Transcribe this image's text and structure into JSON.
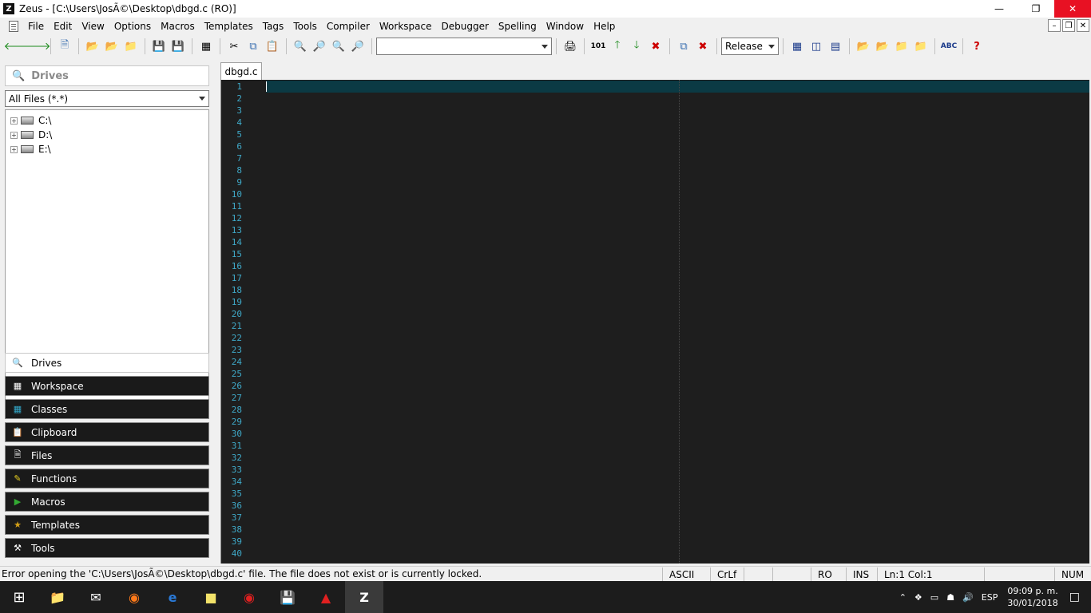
{
  "window": {
    "app_icon": "Z",
    "title": "Zeus - [C:\\Users\\JosÃ©\\Desktop\\dbgd.c (RO)]",
    "buttons": [
      "minimize-icon",
      "restore-icon",
      "close-icon"
    ]
  },
  "menu": {
    "items": [
      "File",
      "Edit",
      "View",
      "Options",
      "Macros",
      "Templates",
      "Tags",
      "Tools",
      "Compiler",
      "Workspace",
      "Debugger",
      "Spelling",
      "Window",
      "Help"
    ]
  },
  "toolbar": {
    "search_combo_value": "",
    "config_combo_value": "Release"
  },
  "leftpanel": {
    "header": "Drives",
    "filter": "All Files (*.*)",
    "tree": [
      "C:\\",
      "D:\\",
      "E:\\"
    ],
    "buttons": [
      "Drives",
      "Workspace",
      "Classes",
      "Clipboard",
      "Files",
      "Functions",
      "Macros",
      "Templates",
      "Tools"
    ]
  },
  "editor": {
    "tab": "dbgd.c",
    "line_count": 40
  },
  "status": {
    "message": "Error opening the 'C:\\Users\\JosÃ©\\Desktop\\dbgd.c' file. The file does not exist or is currently locked.",
    "encoding": "ASCII",
    "line_ending": "CrLf",
    "mode": "RO",
    "insert": "INS",
    "position": "Ln:1 Col:1",
    "numlock": "NUM"
  },
  "taskbar": {
    "language": "ESP",
    "time": "09:09 p. m.",
    "date": "30/01/2018"
  }
}
